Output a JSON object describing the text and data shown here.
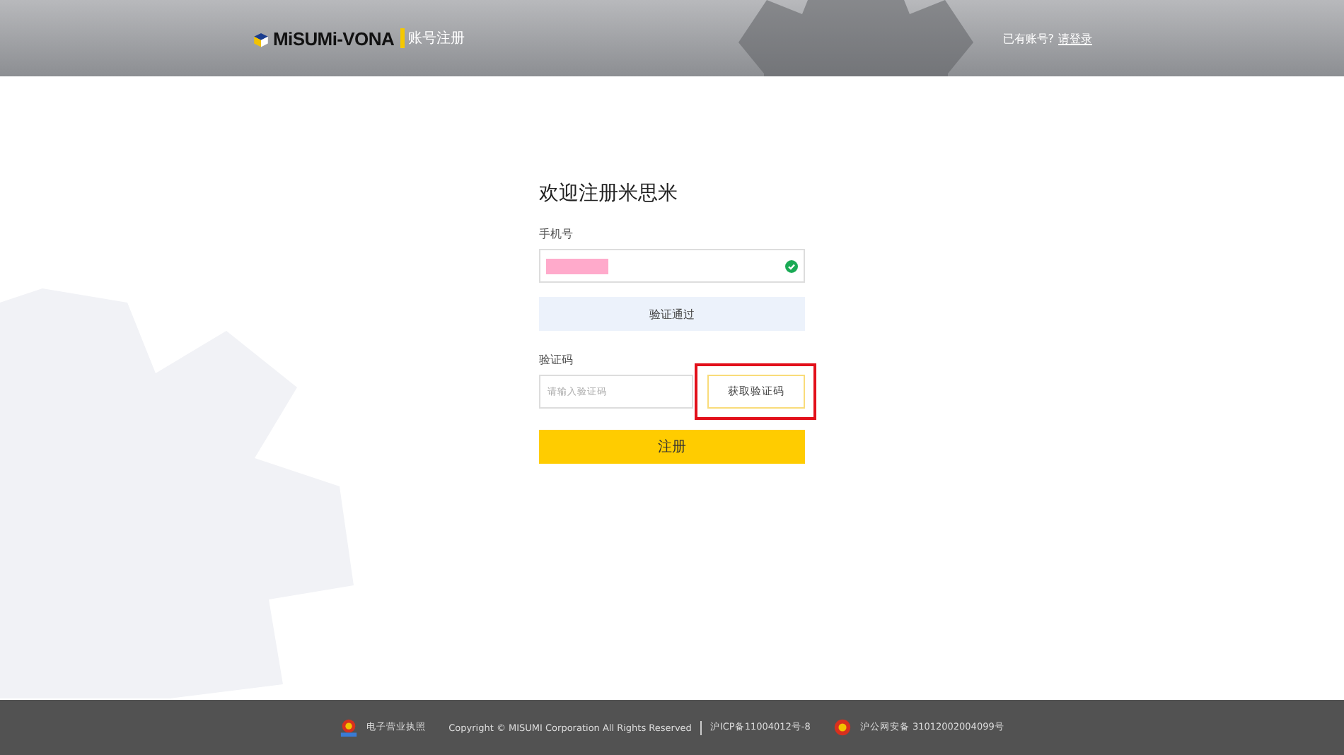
{
  "header": {
    "logo": "MiSUMi-VONA",
    "subtitle": "账号注册",
    "login_prompt": "已有账号?",
    "login_link": "请登录"
  },
  "form": {
    "title": "欢迎注册米思米",
    "phone_label": "手机号",
    "phone_redacted": true,
    "phone_verified": true,
    "verify_banner": "验证通过",
    "code_label": "验证码",
    "code_placeholder": "请输入验证码",
    "get_code_button": "获取验证码",
    "get_code_highlighted": true,
    "submit": "注册"
  },
  "footer": {
    "license": "电子营业执照",
    "copyright": "Copyright © MISUMI Corporation All Rights Reserved",
    "icp": "沪ICP备11004012号-8",
    "police": "沪公网安备 31012002004099号"
  }
}
